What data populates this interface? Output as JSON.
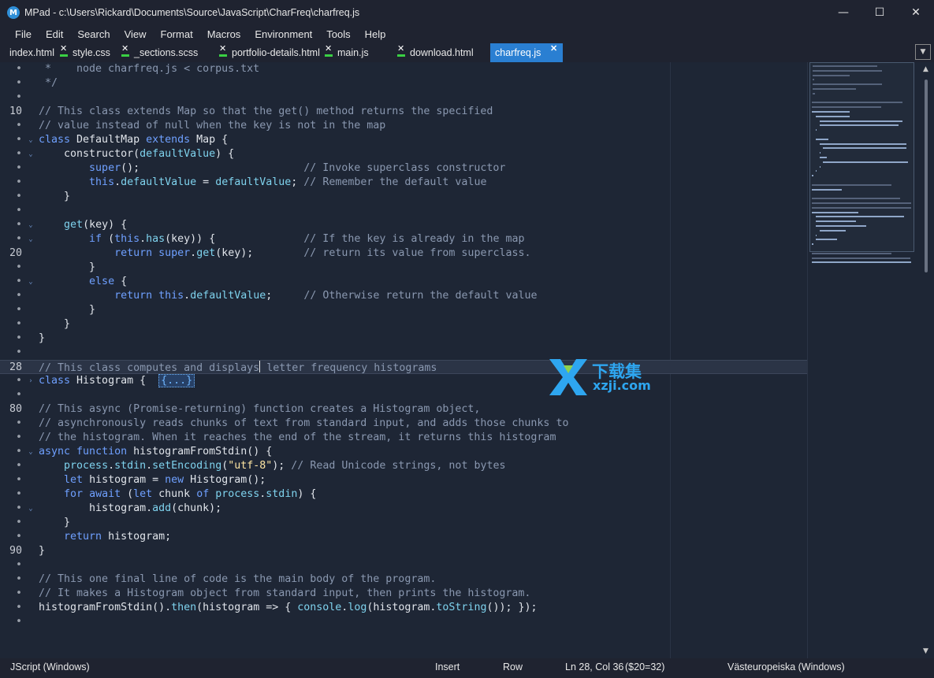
{
  "window": {
    "app_name": "MPad",
    "title": "MPad - c:\\Users\\Rickard\\Documents\\Source\\JavaScript\\CharFreq\\charfreq.js",
    "minimize": "—",
    "maximize": "☐",
    "close": "✕"
  },
  "menu": [
    "File",
    "Edit",
    "Search",
    "View",
    "Format",
    "Macros",
    "Environment",
    "Tools",
    "Help"
  ],
  "tabs": [
    {
      "label": "index.html",
      "modified": false,
      "active": false
    },
    {
      "label": "style.css",
      "modified": true,
      "active": false
    },
    {
      "label": "_sections.scss",
      "modified": true,
      "active": false
    },
    {
      "label": "portfolio-details.html",
      "modified": true,
      "active": false
    },
    {
      "label": "main.js",
      "modified": true,
      "active": false
    },
    {
      "label": "download.html",
      "modified": true,
      "active": false
    },
    {
      "label": "charfreq.js",
      "modified": false,
      "active": true
    }
  ],
  "tab_close_glyph": "✕",
  "tab_dropdown_glyph": "▼",
  "gutter": {
    "line_numbers": [
      "•",
      "•",
      "•",
      "10",
      "•",
      "•",
      "•",
      "•",
      "•",
      "•",
      "•",
      "•",
      "•",
      "20",
      "•",
      "•",
      "•",
      "•",
      "•",
      "•",
      "•",
      "28",
      "•",
      "•",
      "80",
      "•",
      "•",
      "•",
      "•",
      "•",
      "•",
      "•",
      "•",
      "•",
      "90",
      "•",
      "•",
      "•",
      "•",
      "•"
    ],
    "fold_markers": [
      "",
      "",
      "",
      "",
      "",
      "open",
      "open",
      "",
      "",
      "",
      "",
      "open",
      "open",
      "",
      "",
      "open",
      "",
      "",
      "",
      "",
      "",
      "",
      "closed",
      "",
      "",
      "",
      "",
      "open",
      "",
      "",
      "",
      "open",
      "",
      "",
      "",
      "",
      "",
      "",
      "",
      ""
    ]
  },
  "code_lines": [
    " *    node charfreq.js < corpus.txt",
    " */",
    "",
    "// This class extends Map so that the get() method returns the specified",
    "// value instead of null when the key is not in the map",
    "class DefaultMap extends Map {",
    "    constructor(defaultValue) {",
    "        super();                          // Invoke superclass constructor",
    "        this.defaultValue = defaultValue; // Remember the default value",
    "    }",
    "",
    "    get(key) {",
    "        if (this.has(key)) {              // If the key is already in the map",
    "            return super.get(key);        // return its value from superclass.",
    "        }",
    "        else {",
    "            return this.defaultValue;     // Otherwise return the default value",
    "        }",
    "    }",
    "}",
    "",
    "// This class computes and displays letter frequency histograms",
    "class Histogram {  {...}",
    "",
    "// This async (Promise-returning) function creates a Histogram object,",
    "// asynchronously reads chunks of text from standard input, and adds those chunks to",
    "// the histogram. When it reaches the end of the stream, it returns this histogram",
    "async function histogramFromStdin() {",
    "    process.stdin.setEncoding(\"utf-8\"); // Read Unicode strings, not bytes",
    "    let histogram = new Histogram();",
    "    for await (let chunk of process.stdin) {",
    "        histogram.add(chunk);",
    "    }",
    "    return histogram;",
    "}",
    "",
    "// This one final line of code is the main body of the program.",
    "// It makes a Histogram object from standard input, then prints the histogram.",
    "histogramFromStdin().then(histogram => { console.log(histogram.toString()); });",
    ""
  ],
  "status": {
    "language": "JScript (Windows)",
    "mode": "Insert",
    "selection_mode": "Row",
    "position": "Ln 28, Col 36",
    "char": "($20=32)",
    "encoding": "Västeuropeiska (Windows)"
  },
  "watermark": {
    "cn": "下载集",
    "url": "xzji.com"
  },
  "colors": {
    "background": "#1e2635",
    "comment": "#8a98b0",
    "keyword": "#6fa0ff",
    "identifier": "#7fd3ee",
    "string": "#ffe6a3",
    "active_tab": "#2a7fd2",
    "modified_marker": "#3ad043"
  }
}
